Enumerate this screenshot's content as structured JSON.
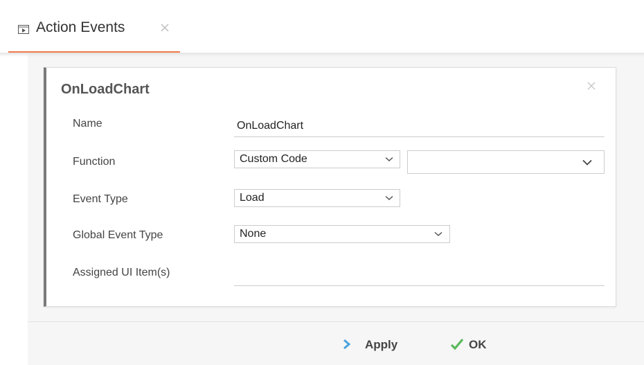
{
  "tab": {
    "label": "Action Events",
    "icon": "play-panel-icon"
  },
  "panel": {
    "title": "OnLoadChart",
    "fields": {
      "name_label": "Name",
      "name_value": "OnLoadChart",
      "function_label": "Function",
      "function_value": "Custom Code",
      "function_secondary_value": "",
      "event_type_label": "Event Type",
      "event_type_value": "Load",
      "global_event_type_label": "Global Event Type",
      "global_event_type_value": "None",
      "assigned_ui_items_label": "Assigned UI Item(s)",
      "assigned_ui_items_value": ""
    }
  },
  "footer": {
    "apply_label": "Apply",
    "ok_label": "OK"
  },
  "colors": {
    "tab_underline": "#f07a4a",
    "apply_icon": "#4aa3df",
    "ok_icon": "#5cb85c",
    "panel_left_border": "#7a7a7a"
  }
}
